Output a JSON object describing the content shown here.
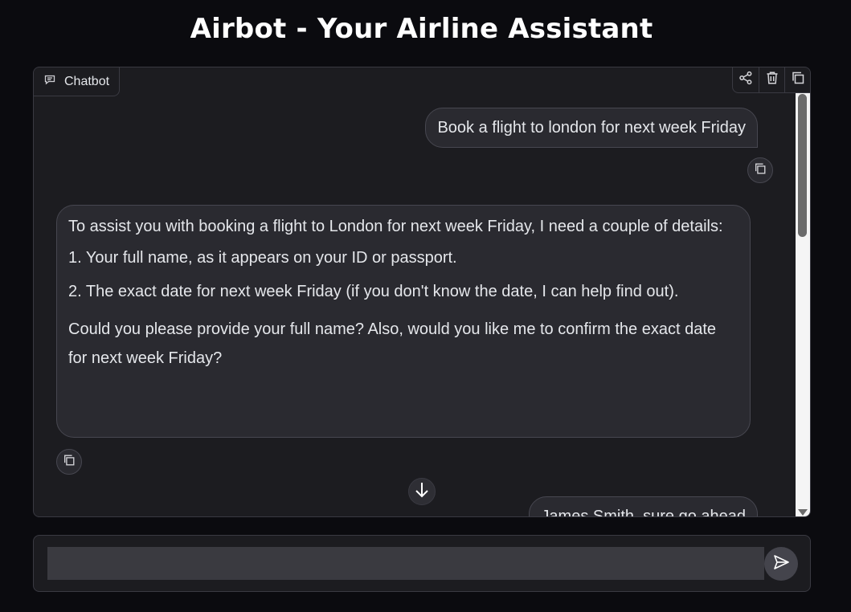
{
  "app": {
    "title": "Airbot - Your Airline Assistant"
  },
  "chatbot": {
    "label": "Chatbot",
    "toolbar": {
      "icons": [
        "share-icon",
        "trash-icon",
        "copy-icon"
      ]
    }
  },
  "messages": [
    {
      "role": "user",
      "text": "Book a flight to london for next week Friday"
    },
    {
      "role": "assistant",
      "paragraphs": [
        "To assist you with booking a flight to London for next week Friday, I need a couple of details:",
        "1. Your full name, as it appears on your ID or passport.",
        "2. The exact date for next week Friday (if you don't know the date, I can help find out).",
        "Could you please provide your full name? Also, would you like me to confirm the exact date for next week Friday?"
      ]
    },
    {
      "role": "user",
      "text": "James Smith, sure go ahead"
    }
  ],
  "input": {
    "placeholder": "",
    "value": ""
  },
  "colors": {
    "background": "#0b0b0f",
    "panel": "#1c1c20",
    "bubble": "#2a2a30",
    "border": "#3a3a42"
  }
}
